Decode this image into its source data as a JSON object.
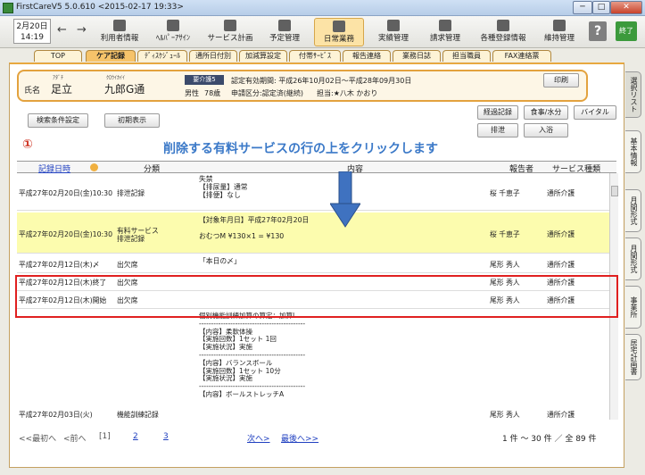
{
  "window": {
    "title": "FirstCareV5 5.0.610 <2015-02-17 19:33>",
    "min": "─",
    "max": "□",
    "close": "✕"
  },
  "toolbar": {
    "date": "2月20日",
    "time": "14:19",
    "prev": "←",
    "next": "→",
    "buttons": [
      "利用者情報",
      "ﾍﾙﾊﾟｰｱｻｲﾝ",
      "サービス計画",
      "予定管理",
      "日常業務",
      "実績管理",
      "請求管理",
      "各種登録情報",
      "維持管理"
    ],
    "help": "?",
    "finish": "終了"
  },
  "tabs": [
    "TOP",
    "ケア記録",
    "ﾃﾞｨｽｹｼﾞｭｰﾙ",
    "通所日付別",
    "加減算設定",
    "付帯ｻｰﾋﾞｽ",
    "報告連絡",
    "業務日誌",
    "担当職員",
    "FAX連絡票"
  ],
  "patient": {
    "label": "氏名",
    "kana_last": "ｱﾀﾞﾁ",
    "kana_first": "ｸﾛｳｲｶｲｲ",
    "last": "足立",
    "first": "九郎G通",
    "care_level": "要介護5",
    "validity": "認定有効期間: 平成26年10月02日〜平成28年09月30日",
    "gender": "男性",
    "age": "78歳",
    "application": "申請区分:認定済(継続)",
    "manager": "担当:★八木 かおり"
  },
  "buttons": {
    "print": "印刷",
    "search": "検索条件設定",
    "init": "初期表示",
    "progress": "経過記録",
    "meal": "食事/水分",
    "vital": "バイタル",
    "excretion": "排泄",
    "bath": "入浴"
  },
  "instruction": "削除する有料サービスの行の上をクリックします",
  "step": "①",
  "table": {
    "headers": [
      "記録日時",
      "分類",
      "内容",
      "報告者",
      "サービス種類"
    ],
    "rows": [
      {
        "date": "平成27年02月20日(金)10:30",
        "cat": "排泄記録",
        "content": "失禁\n【排尿量】通常\n【排便】なし",
        "reporter": "桜 千恵子",
        "svc": "通所介護"
      },
      {
        "date": "平成27年02月20日(金)10:30",
        "cat": "有料サービス\n排泄記録",
        "content": "【対象年月日】平成27年02月20日\n\nおむつM ¥130×1 = ¥130",
        "reporter": "桜 千恵子",
        "svc": "通所介護"
      },
      {
        "date": "平成27年02月12日(木)〆",
        "cat": "出欠席",
        "content": "「本日の〆」",
        "reporter": "尾形 秀人",
        "svc": "通所介護"
      },
      {
        "date": "平成27年02月12日(木)終了",
        "cat": "出欠席",
        "content": "",
        "reporter": "尾形 秀人",
        "svc": "通所介護"
      },
      {
        "date": "平成27年02月12日(木)開始",
        "cat": "出欠席",
        "content": "",
        "reporter": "尾形 秀人",
        "svc": "通所介護"
      },
      {
        "date": "平成27年02月03日(火)",
        "cat": "機能訓練記録",
        "content": "個別機能訓練加算の算定：加算Ⅰ\n--------------------------------------------\n【内容】柔軟体操\n【実施回数】1セット 1回\n【実施状況】実施\n--------------------------------------------\n【内容】バランスボール\n【実施回数】1セット 10分\n【実施状況】実施\n--------------------------------------------\n【内容】ボールストレッチA",
        "reporter": "尾形 秀人",
        "svc": "通所介護"
      }
    ]
  },
  "footer": {
    "first": "<<最初へ",
    "prev": "<前へ",
    "p1": "[1]",
    "p2": "2",
    "p3": "3",
    "next": "次へ>",
    "last": "最後へ>>",
    "count": "1 件 〜 30 件 ／ 全 89 件"
  },
  "side": [
    "選択リスト",
    "基本情報",
    "月間形式",
    "月間形式",
    "事業所",
    "居宅計画書"
  ],
  "colors": {
    "highlight": "#fcfcae",
    "red_box": "#e02020",
    "instruction": "#3b79c8"
  }
}
